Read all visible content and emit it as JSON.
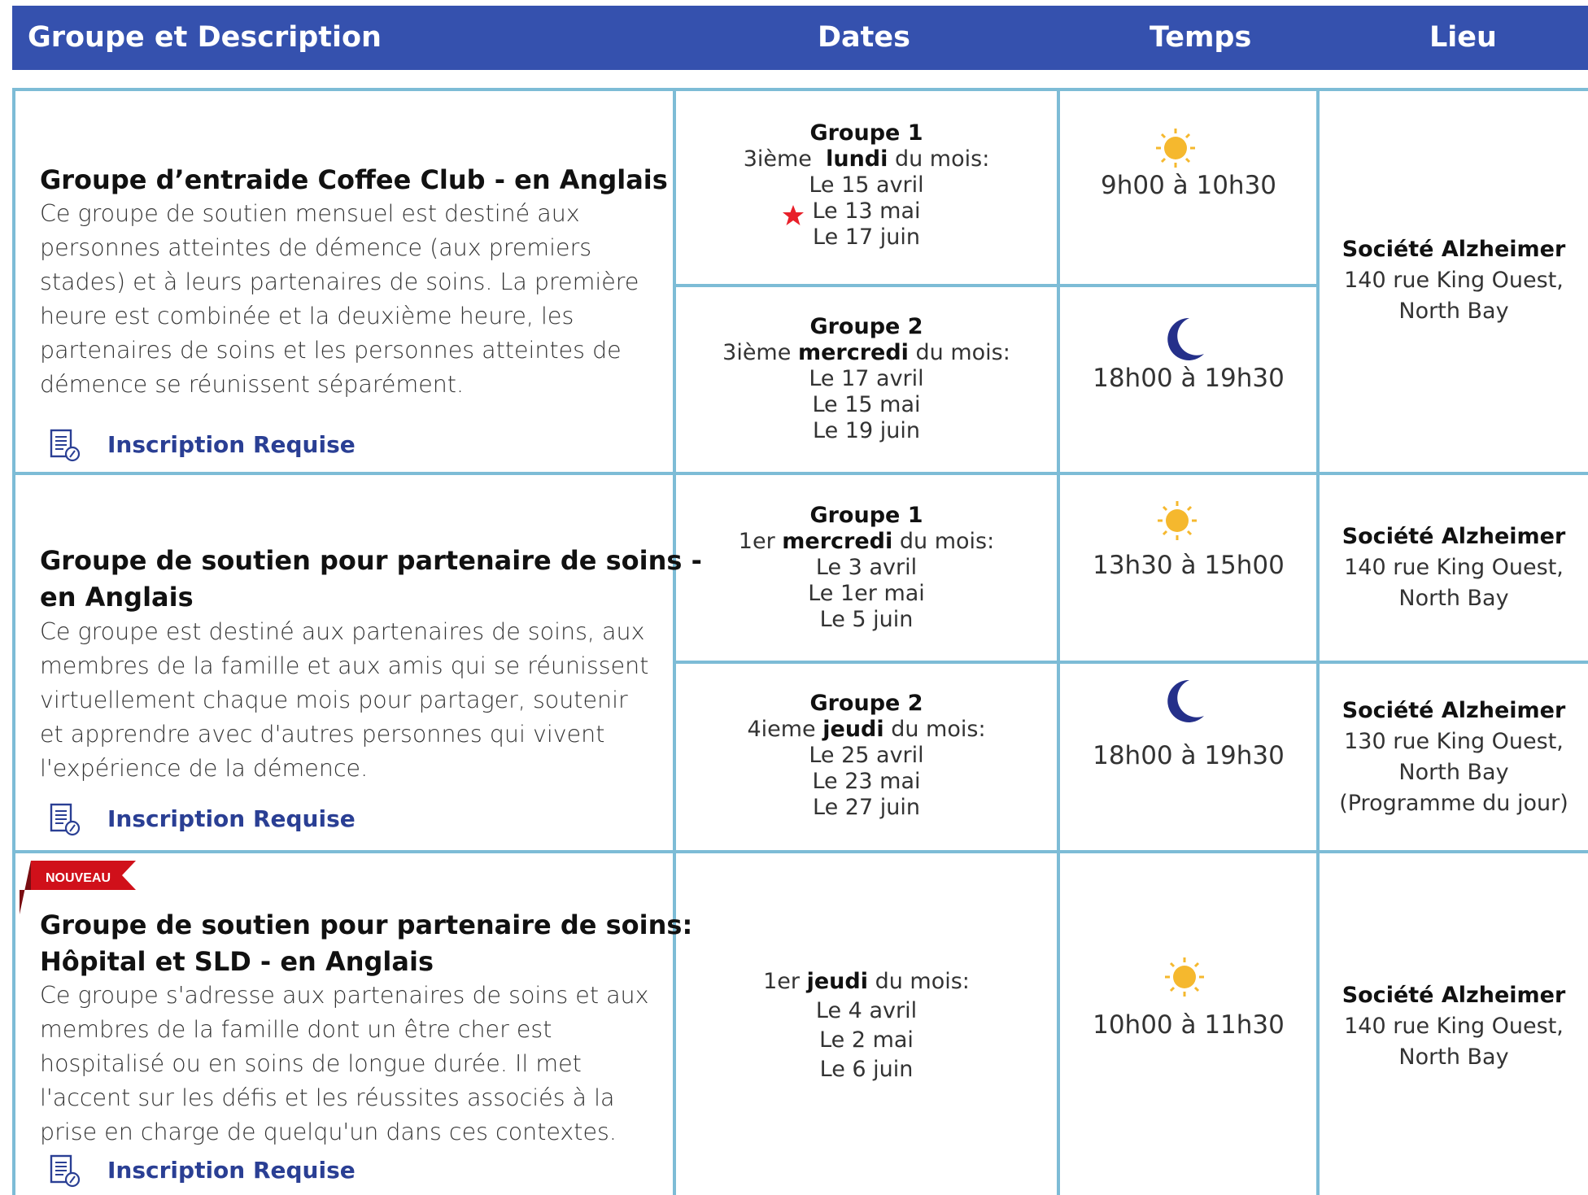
{
  "header": {
    "col_group": "Groupe et Description",
    "col_dates": "Dates",
    "col_time": "Temps",
    "col_place": "Lieu"
  },
  "rows": [
    {
      "title": "Groupe d’entraide Coffee Club - en Anglais",
      "description": "Ce groupe de soutien mensuel est destiné aux personnes atteintes de démence (aux premiers stades) et à leurs partenaires de soins. La première heure est combinée et la deuxième heure, les partenaires de soins et les personnes atteintes de démence se réunissent séparément.",
      "registration": "Inscription Requise",
      "sessions": [
        {
          "group": "Groupe 1",
          "freq_prefix": "3ième",
          "day": "lundi",
          "freq_suffix": "du mois:",
          "dates": [
            "Le 15 avril",
            "Le 13 mai",
            "Le 17 juin"
          ],
          "time": "9h00 à 10h30",
          "time_icon": "sun-icon"
        },
        {
          "group": "Groupe 2",
          "freq_prefix": "3ième",
          "day": "mercredi",
          "freq_suffix": "du mois:",
          "dates": [
            "Le 17 avril",
            "Le 15 mai",
            "Le 19 juin"
          ],
          "time": "18h00 à 19h30",
          "time_icon": "moon-icon"
        }
      ],
      "place": {
        "name": "Société Alzheimer",
        "address1": "140 rue King Ouest,",
        "address2": "North Bay"
      }
    },
    {
      "title_line1": "Groupe de soutien pour partenaire de soins -",
      "title_line2": "en Anglais",
      "description": "Ce groupe est destiné aux partenaires de soins, aux membres de la famille et aux amis qui se réunissent virtuellement chaque mois pour partager, soutenir et apprendre avec d'autres personnes qui vivent l'expérience de la démence.",
      "registration": "Inscription Requise",
      "sessions": [
        {
          "group": "Groupe 1",
          "freq_prefix": "1er",
          "day": "mercredi",
          "freq_suffix": "du mois:",
          "dates": [
            "Le 3 avril",
            "Le 1er mai",
            "Le 5 juin"
          ],
          "time": "13h30 à 15h00",
          "time_icon": "sun-icon",
          "place": {
            "name": "Société Alzheimer",
            "address1": "140 rue King Ouest,",
            "address2": "North Bay"
          }
        },
        {
          "group": "Groupe 2",
          "freq_prefix": "4ieme",
          "day": "jeudi",
          "freq_suffix": "du mois:",
          "dates": [
            "Le 25 avril",
            "Le 23 mai",
            "Le 27 juin"
          ],
          "time": "18h00 à 19h30",
          "time_icon": "moon-icon",
          "place": {
            "name": "Société Alzheimer",
            "address1": "130 rue King Ouest,",
            "address2": "North Bay",
            "address3": "(Programme du jour)"
          }
        }
      ]
    },
    {
      "badge": "NOUVEAU",
      "title_line1": "Groupe de soutien pour partenaire de soins:",
      "title_line2": "Hôpital et SLD - en Anglais",
      "description": "Ce groupe s'adresse aux partenaires de soins et aux membres de la famille dont un être cher est hospitalisé ou en soins de longue durée. Il met l'accent sur les défis et les réussites associés à la prise en charge de quelqu'un dans ces contextes.",
      "registration": "Inscription Requise",
      "freq_prefix": "1er",
      "day": "jeudi",
      "freq_suffix": "du mois:",
      "dates": [
        "Le 4 avril",
        "Le 2 mai",
        "Le 6 juin"
      ],
      "time": "10h00 à 11h30",
      "time_icon": "sun-icon",
      "place": {
        "name": "Société Alzheimer",
        "address1": "140 rue King Ouest,",
        "address2": "North Bay"
      }
    }
  ],
  "colors": {
    "header_bg": "#3551ae",
    "border": "#7dbcd6",
    "link": "#2a3f94",
    "sun": "#f5b82e",
    "moon": "#25308a",
    "badge": "#d0101a",
    "star": "#e8202a"
  }
}
